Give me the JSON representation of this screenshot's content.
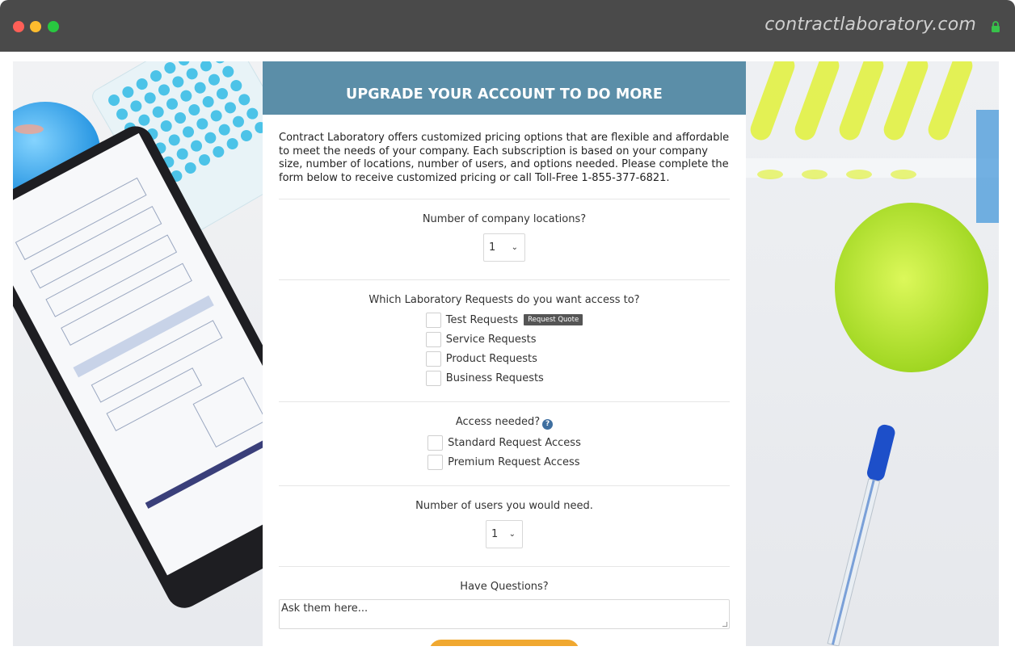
{
  "browser": {
    "url": "contractlaboratory.com",
    "lock_icon": "lock-icon"
  },
  "form": {
    "heading": "UPGRADE YOUR ACCOUNT TO DO MORE",
    "intro": "Contract Laboratory offers customized pricing options that are flexible and affordable to meet the needs of your company. Each subscription is based on your company size, number of locations, number of users, and options needed. Please complete the form below to receive customized pricing or call Toll-Free 1-855-377-6821.",
    "locations": {
      "question": "Number of company locations?",
      "value": "1"
    },
    "lab_requests": {
      "question": "Which Laboratory Requests do you want access to?",
      "options": [
        {
          "label": "Test Requests",
          "badge": "Request Quote"
        },
        {
          "label": "Service Requests"
        },
        {
          "label": "Product Requests"
        },
        {
          "label": "Business Requests"
        }
      ]
    },
    "access": {
      "question": "Access needed?",
      "help_icon": "?",
      "options": [
        {
          "label": "Standard Request Access"
        },
        {
          "label": "Premium Request Access"
        }
      ]
    },
    "users": {
      "question": "Number of users you would need.",
      "value": "1"
    },
    "questions": {
      "label": "Have Questions?",
      "placeholder": "Ask them here..."
    }
  },
  "colors": {
    "banner": "#5b8ea8",
    "submit": "#f0a830",
    "chrome": "#4a4a4a"
  }
}
